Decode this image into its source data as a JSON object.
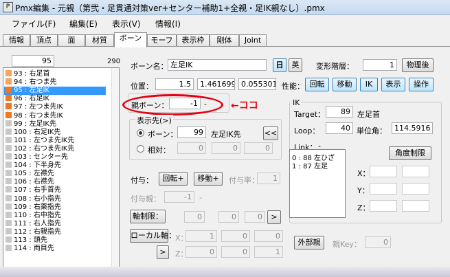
{
  "window": {
    "title": "Pmx編集 - 元親（第弐・足貫通対策ver+センター補助1+全親・足IK親なし）.pmx",
    "icon_label": "P"
  },
  "menu": [
    "ファイル(F)",
    "編集(E)",
    "表示(V)",
    "情報(I)"
  ],
  "tabs": [
    "情報",
    "頂点",
    "面",
    "材質",
    "ボーン",
    "モーフ",
    "表示枠",
    "剛体",
    "Joint"
  ],
  "active_tab": "ボーン",
  "list": {
    "selected_index": "95",
    "total": "290",
    "items": [
      {
        "text": "93 : 右足首",
        "color": "#f5a460"
      },
      {
        "text": "94 : 右つま先",
        "color": "#f5a460"
      },
      {
        "text": "95 : 左足IK",
        "color": "#f07820",
        "selected": true
      },
      {
        "text": "96 : 右足IK",
        "color": "#f07820"
      },
      {
        "text": "97 : 左つま先IK",
        "color": "#f07820"
      },
      {
        "text": "98 : 右つま先IK",
        "color": "#f07820"
      },
      {
        "text": "99 : 左足IK先",
        "color": "#c8c8c8"
      },
      {
        "text": "100 : 右足IK先",
        "color": "#c8c8c8"
      },
      {
        "text": "101 : 左つま先IK先",
        "color": "#c8c8c8"
      },
      {
        "text": "102 : 右つま先IK先",
        "color": "#c8c8c8"
      },
      {
        "text": "103 : センター先",
        "color": "#c8c8c8"
      },
      {
        "text": "104 : 下半身先",
        "color": "#c8c8c8"
      },
      {
        "text": "105 : 左襟先",
        "color": "#c8c8c8"
      },
      {
        "text": "106 : 右襟先",
        "color": "#c8c8c8"
      },
      {
        "text": "107 : 右手首先",
        "color": "#c8c8c8"
      },
      {
        "text": "108 : 右小指先",
        "color": "#c8c8c8"
      },
      {
        "text": "109 : 右薬指先",
        "color": "#c8c8c8"
      },
      {
        "text": "110 : 右中指先",
        "color": "#c8c8c8"
      },
      {
        "text": "111 : 右人指先",
        "color": "#c8c8c8"
      },
      {
        "text": "112 : 右親指先",
        "color": "#c8c8c8"
      },
      {
        "text": "113 : 頭先",
        "color": "#c8c8c8"
      },
      {
        "text": "114 : 両目先",
        "color": "#c8c8c8"
      }
    ]
  },
  "bone": {
    "name_label": "ボーン名：",
    "name_value": "左足IK",
    "lang_jp": "日",
    "lang_en": "英",
    "transform_label": "変形階層：",
    "transform_value": "1",
    "physics_after": "物理後",
    "position_label": "位置：",
    "pos_x": "1.5",
    "pos_y": "1.461699",
    "pos_z": "0.0553014",
    "perf_label": "性能：",
    "perf_rotate": "回転",
    "perf_move": "移動",
    "perf_ik": "IK",
    "perf_display": "表示",
    "perf_operate": "操作",
    "parent_label": "親ボーン：",
    "parent_value": "-1",
    "parent_dash": "-",
    "annotation": "←ココ",
    "disp_dest_label": "表示先(>)",
    "radio_bone": "ボーン：",
    "dest_value": "99",
    "dest_name": "左足IK先",
    "dest_btn": "<<",
    "radio_relative": "相対：",
    "rel_x": "0",
    "rel_y": "0",
    "rel_z": "0",
    "grant_label": "付与：",
    "grant_rotate": "回転+",
    "grant_move": "移動+",
    "grant_rate_label": "付与率：",
    "grant_rate": "1",
    "grant_parent_label": "付与親：",
    "grant_parent": "-1",
    "grant_parent_dash": "-",
    "axis_btn": "軸制限：",
    "axis_x": "0",
    "axis_y": "0",
    "axis_z": "0",
    "axis_go": ">",
    "local_btn": "ローカル軸：",
    "lx_label": "X：",
    "lx1": "1",
    "lx2": "0",
    "lx3": "0",
    "lz_label": "Z：",
    "lz_go": ">",
    "lz1": "0",
    "lz2": "0",
    "lz3": "1",
    "external_btn": "外部親",
    "parent_key_label": "親Key：",
    "parent_key": "0"
  },
  "ik": {
    "group": "IK",
    "target_label": "Target：",
    "target_value": "89",
    "target_name": "左足首",
    "loop_label": "Loop：",
    "loop_value": "40",
    "unit_label": "単位角：",
    "unit_value": "114.5916",
    "link_label": "Link：",
    "link_dash": "-",
    "angle_btn": "角度制限",
    "links": [
      "0 : 88 左ひざ",
      "1 : 87 左足"
    ],
    "x_label": "X：",
    "y_label": "Y：",
    "z_label": "Z："
  }
}
